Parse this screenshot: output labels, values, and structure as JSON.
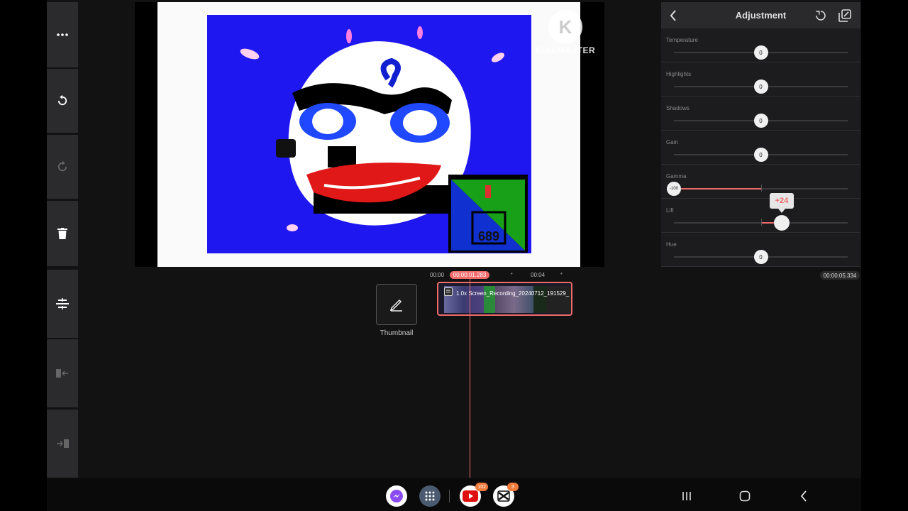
{
  "preview": {
    "watermark_letter": "K",
    "watermark_text": "KINEMASTER",
    "scene_counter": "689"
  },
  "adjustment": {
    "title": "Adjustment",
    "sliders": [
      {
        "label": "Temperature",
        "value": "0",
        "fraction": 0.5
      },
      {
        "label": "Highlights",
        "value": "0",
        "fraction": 0.5
      },
      {
        "label": "Shadows",
        "value": "0",
        "fraction": 0.5
      },
      {
        "label": "Gain",
        "value": "0",
        "fraction": 0.5
      },
      {
        "label": "Gamma",
        "value": "-100",
        "fraction": 0.0
      },
      {
        "label": "Lift",
        "value": "+24",
        "fraction": 0.62
      },
      {
        "label": "Hue",
        "value": "0",
        "fraction": 0.5
      }
    ],
    "accent_color": "#f06a6a"
  },
  "timeline": {
    "ruler_start": "00:00",
    "ruler_mid": "00:04",
    "playhead_time": "00:00:01.283",
    "total_time": "00:00:05.334",
    "clip_title": "1.0x Screen_Recording_20240712_191529_",
    "thumbnail_label": "Thumbnail"
  },
  "dock": {
    "youtube_badge": "102",
    "capcut_badge": "3"
  }
}
